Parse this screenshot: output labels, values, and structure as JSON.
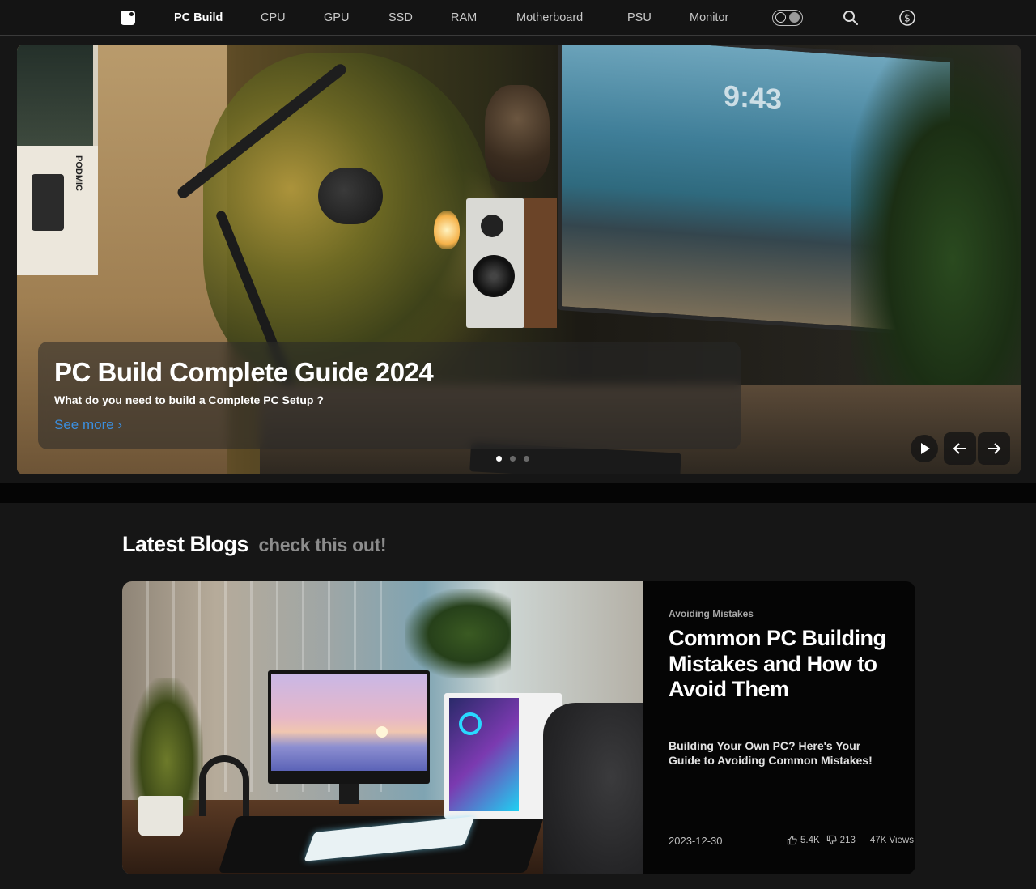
{
  "nav": {
    "items": [
      {
        "label": "PC Build",
        "active": true
      },
      {
        "label": "CPU"
      },
      {
        "label": "GPU"
      },
      {
        "label": "SSD"
      },
      {
        "label": "RAM"
      },
      {
        "label": "Motherboard"
      },
      {
        "label": "PSU"
      },
      {
        "label": "Monitor"
      }
    ],
    "icons": [
      "logo-icon",
      "theme-toggle",
      "search-icon",
      "dollar-icon"
    ]
  },
  "hero": {
    "title": "PC Build Complete Guide 2024",
    "subtitle": "What do you need to build a Complete PC Setup ?",
    "link": "See more ›",
    "slides_count": 3,
    "active_slide": 1,
    "screen_clock": "9:43",
    "box_label": "PODMIC",
    "controls": [
      "play-icon",
      "arrow-left-icon",
      "arrow-right-icon"
    ]
  },
  "blogs": {
    "title": "Latest Blogs",
    "subtitle": "check this out!",
    "posts": [
      {
        "category": "Avoiding Mistakes",
        "title": "Common PC Building Mistakes and How to Avoid Them",
        "description": "Building Your Own PC? Here's Your Guide to Avoiding Common Mistakes!",
        "date": "2023-12-30",
        "likes": "5.4K",
        "dislikes": "213",
        "views": "47K Views"
      }
    ]
  },
  "colors": {
    "background": "#161616",
    "nav_bg": "#141414",
    "link": "#3b8fe0",
    "card_bg": "#050505"
  }
}
